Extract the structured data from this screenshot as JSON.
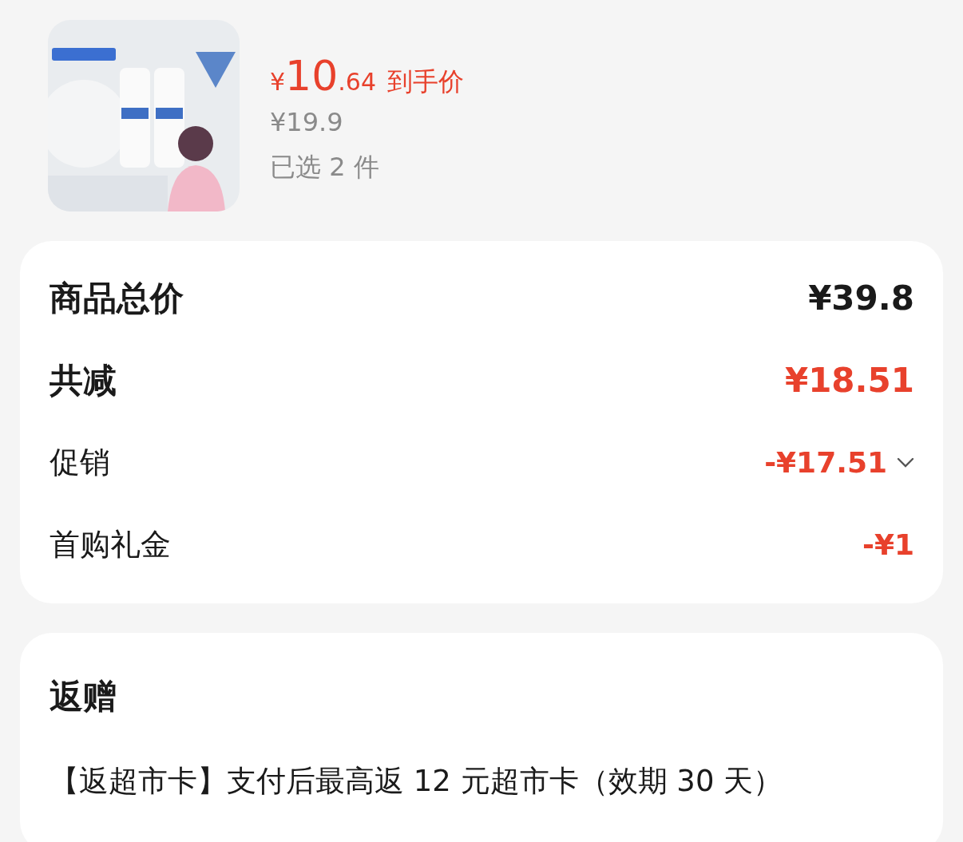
{
  "product": {
    "price": {
      "symbol": "¥",
      "integer": "10",
      "decimal": ".64",
      "label": "到手价"
    },
    "original_price": "¥19.9",
    "selection": "已选 2 件"
  },
  "price_card": {
    "rows": [
      {
        "kind": "total",
        "label": "商品总价",
        "value": "¥39.8",
        "highlight": false,
        "expandable": false
      },
      {
        "kind": "total",
        "label": "共减",
        "value": "¥18.51",
        "highlight": true,
        "expandable": false
      },
      {
        "kind": "detail",
        "label": "促销",
        "value": "-¥17.51",
        "highlight": true,
        "expandable": true
      },
      {
        "kind": "detail",
        "label": "首购礼金",
        "value": "-¥1",
        "highlight": true,
        "expandable": false
      }
    ]
  },
  "rebate_card": {
    "title": "返赠",
    "text": "【返超市卡】支付后最高返 12 元超市卡（效期 30 天）"
  }
}
